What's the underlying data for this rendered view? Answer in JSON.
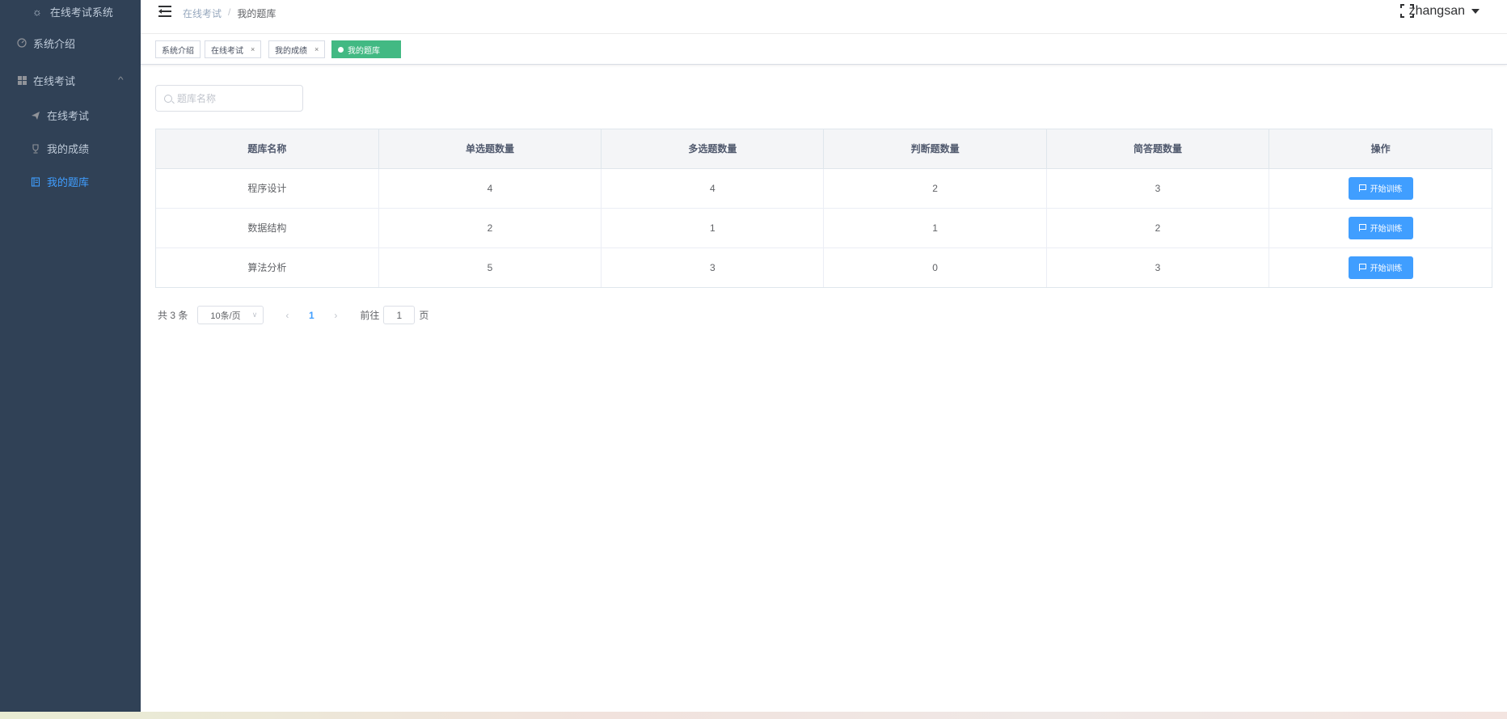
{
  "sidebar": {
    "logo_text": "在线考试系统",
    "items": [
      {
        "label": "系统介绍"
      },
      {
        "label": "在线考试"
      },
      {
        "label": "在线考试"
      },
      {
        "label": "我的成绩"
      },
      {
        "label": "我的题库"
      }
    ]
  },
  "navbar": {
    "breadcrumb": [
      "在线考试",
      "我的题库"
    ],
    "breadcrumb_sep": "/",
    "username": "zhangsan"
  },
  "tags": [
    {
      "label": "系统介绍",
      "closable": false
    },
    {
      "label": "在线考试",
      "closable": true
    },
    {
      "label": "我的成绩",
      "closable": true
    },
    {
      "label": "我的题库",
      "active": true
    }
  ],
  "tag_close_symbol": "×",
  "search": {
    "placeholder": "题库名称",
    "value": ""
  },
  "table": {
    "headers": [
      "题库名称",
      "单选题数量",
      "多选题数量",
      "判断题数量",
      "简答题数量",
      "操作"
    ],
    "rows": [
      {
        "name": "程序设计",
        "single": "4",
        "multi": "4",
        "judge": "2",
        "short": "3",
        "action": "开始训练"
      },
      {
        "name": "数据结构",
        "single": "2",
        "multi": "1",
        "judge": "1",
        "short": "2",
        "action": "开始训练"
      },
      {
        "name": "算法分析",
        "single": "5",
        "multi": "3",
        "judge": "0",
        "short": "3",
        "action": "开始训练"
      }
    ]
  },
  "pagination": {
    "total_text": "共 3 条",
    "page_size": "10条/页",
    "current_page": "1",
    "goto_prefix": "前往",
    "goto_value": "1",
    "goto_suffix": "页"
  },
  "colors": {
    "sidebar_bg": "#304156",
    "primary": "#409eff",
    "active_tag": "#42b983"
  }
}
